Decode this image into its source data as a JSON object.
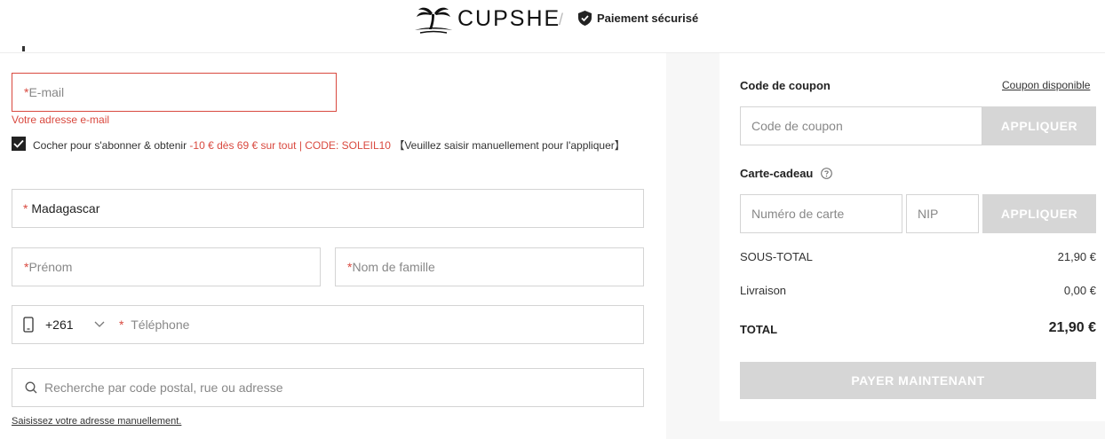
{
  "header": {
    "brand": "CUPSHE",
    "separator": "/",
    "secure_label": "Paiement sécurisé"
  },
  "form": {
    "email": {
      "required_mark": "*",
      "placeholder": "E-mail",
      "error": "Votre adresse e-mail"
    },
    "subscribe": {
      "checked": true,
      "text_before": "Cocher pour s'abonner & obtenir ",
      "promo": "-10 € dès 69 € sur tout | CODE: SOLEIL10",
      "text_after": " 【Veuillez saisir manuellement pour l'appliquer】"
    },
    "country": {
      "required_mark": "*",
      "value": "Madagascar"
    },
    "first_name": {
      "required_mark": "*",
      "placeholder": "Prénom"
    },
    "last_name": {
      "required_mark": "*",
      "placeholder": "Nom de famille"
    },
    "phone": {
      "dial_code": "+261",
      "required_mark": "*",
      "placeholder": "Téléphone"
    },
    "address_search": {
      "placeholder": "Recherche par code postal, rue ou adresse"
    },
    "manual_address_link": "Saisissez votre adresse manuellement."
  },
  "summary": {
    "coupon_title": "Code de coupon",
    "coupon_available_link": "Coupon disponible",
    "coupon_placeholder": "Code de coupon",
    "apply_label": "APPLIQUER",
    "giftcard_title": "Carte-cadeau",
    "card_number_placeholder": "Numéro de carte",
    "pin_placeholder": "NIP",
    "subtotal_label": "SOUS-TOTAL",
    "subtotal_value": "21,90 €",
    "shipping_label": "Livraison",
    "shipping_value": "0,00 €",
    "total_label": "TOTAL",
    "total_value": "21,90 €",
    "pay_label": "PAYER MAINTENANT"
  },
  "colors": {
    "error": "#d9493f",
    "disabled_button": "#d6d6d6",
    "panel_bg": "#f7f7f7"
  }
}
